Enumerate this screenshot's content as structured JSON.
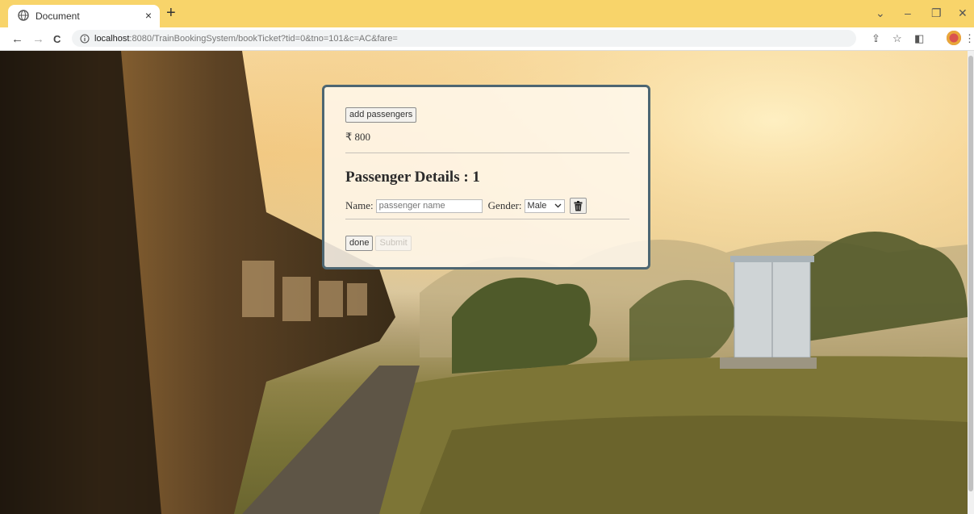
{
  "browser": {
    "tab_title": "Document",
    "tab_close": "×",
    "new_tab": "+",
    "url_host": "localhost",
    "url_path": ":8080/TrainBookingSystem/bookTicket?tid=0&tno=101&c=AC&fare=",
    "window_controls": {
      "chevron": "⌄",
      "minimize": "–",
      "maximize": "❐",
      "close": "✕"
    },
    "nav": {
      "back": "←",
      "forward": "→",
      "reload": "C"
    },
    "toolbar_right": {
      "share": "⇪",
      "star": "☆",
      "sidepanel": "◧",
      "menu": "⋮"
    }
  },
  "form": {
    "add_passengers_label": "add passengers",
    "fare_text": "₹ 800",
    "heading": "Passenger Details : 1",
    "name_label": "Name:",
    "name_placeholder": "passenger name",
    "gender_label": "Gender:",
    "gender_selected": "Male",
    "done_label": "done",
    "submit_label": "Submit"
  },
  "colors": {
    "tab_strip": "#f8d46a",
    "card_border": "#4d6672",
    "card_background": "#fff8ee"
  }
}
